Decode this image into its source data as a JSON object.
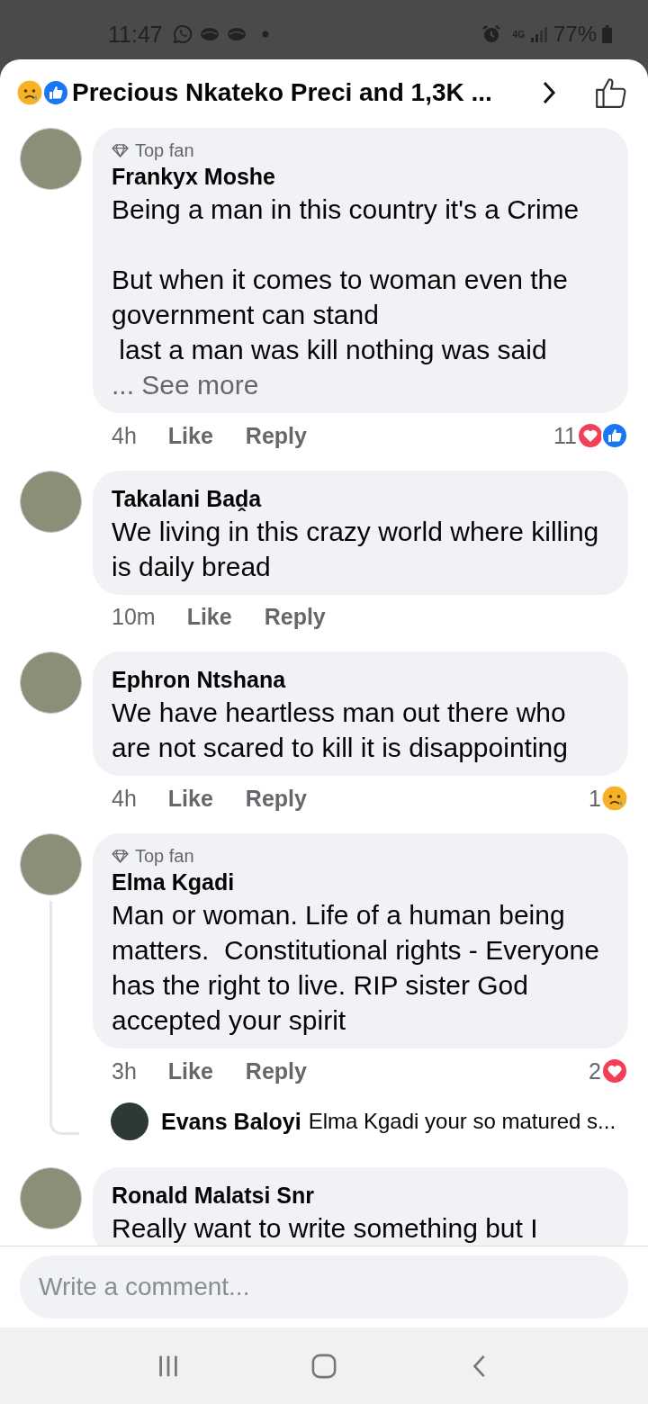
{
  "status_bar": {
    "time": "11:47",
    "network": "4G",
    "battery": "77%"
  },
  "header": {
    "title": "Precious Nkateko Preci and 1,3K ...",
    "reactions": [
      {
        "kind": "sad"
      },
      {
        "kind": "like"
      }
    ]
  },
  "comments": [
    {
      "name": "Frankyx Moshe",
      "badge": "Top fan",
      "text": "Being a man in this country it's a Crime\n\nBut when it comes to woman even the government can stand\n last a man was kill nothing was said",
      "see_more": "... See more",
      "time": "4h",
      "like": "Like",
      "reply": "Reply",
      "reaction_count": "11",
      "reactions": [
        {
          "kind": "love"
        },
        {
          "kind": "like"
        }
      ]
    },
    {
      "name": "Takalani Baḓa",
      "text": "We living in this crazy world where killing is daily bread",
      "time": "10m",
      "like": "Like",
      "reply": "Reply"
    },
    {
      "name": "Ephron Ntshana",
      "text": "We have heartless man out there who are not scared to kill it is disappointing",
      "time": "4h",
      "like": "Like",
      "reply": "Reply",
      "reaction_count": "1",
      "reactions": [
        {
          "kind": "sad"
        }
      ]
    },
    {
      "name": "Elma Kgadi",
      "badge": "Top fan",
      "text": "Man or woman. Life of a human being matters.  Constitutional rights - Everyone has the right to live. RIP sister God accepted your spirit",
      "time": "3h",
      "like": "Like",
      "reply": "Reply",
      "reaction_count": "2",
      "reactions": [
        {
          "kind": "love"
        }
      ],
      "replies": [
        {
          "name": "Evans Baloyi",
          "text": "Elma Kgadi your so matured s..."
        }
      ]
    },
    {
      "name": "Ronald Malatsi Snr",
      "text": "Really want to write something but I"
    }
  ],
  "composer": {
    "placeholder": "Write a comment..."
  }
}
